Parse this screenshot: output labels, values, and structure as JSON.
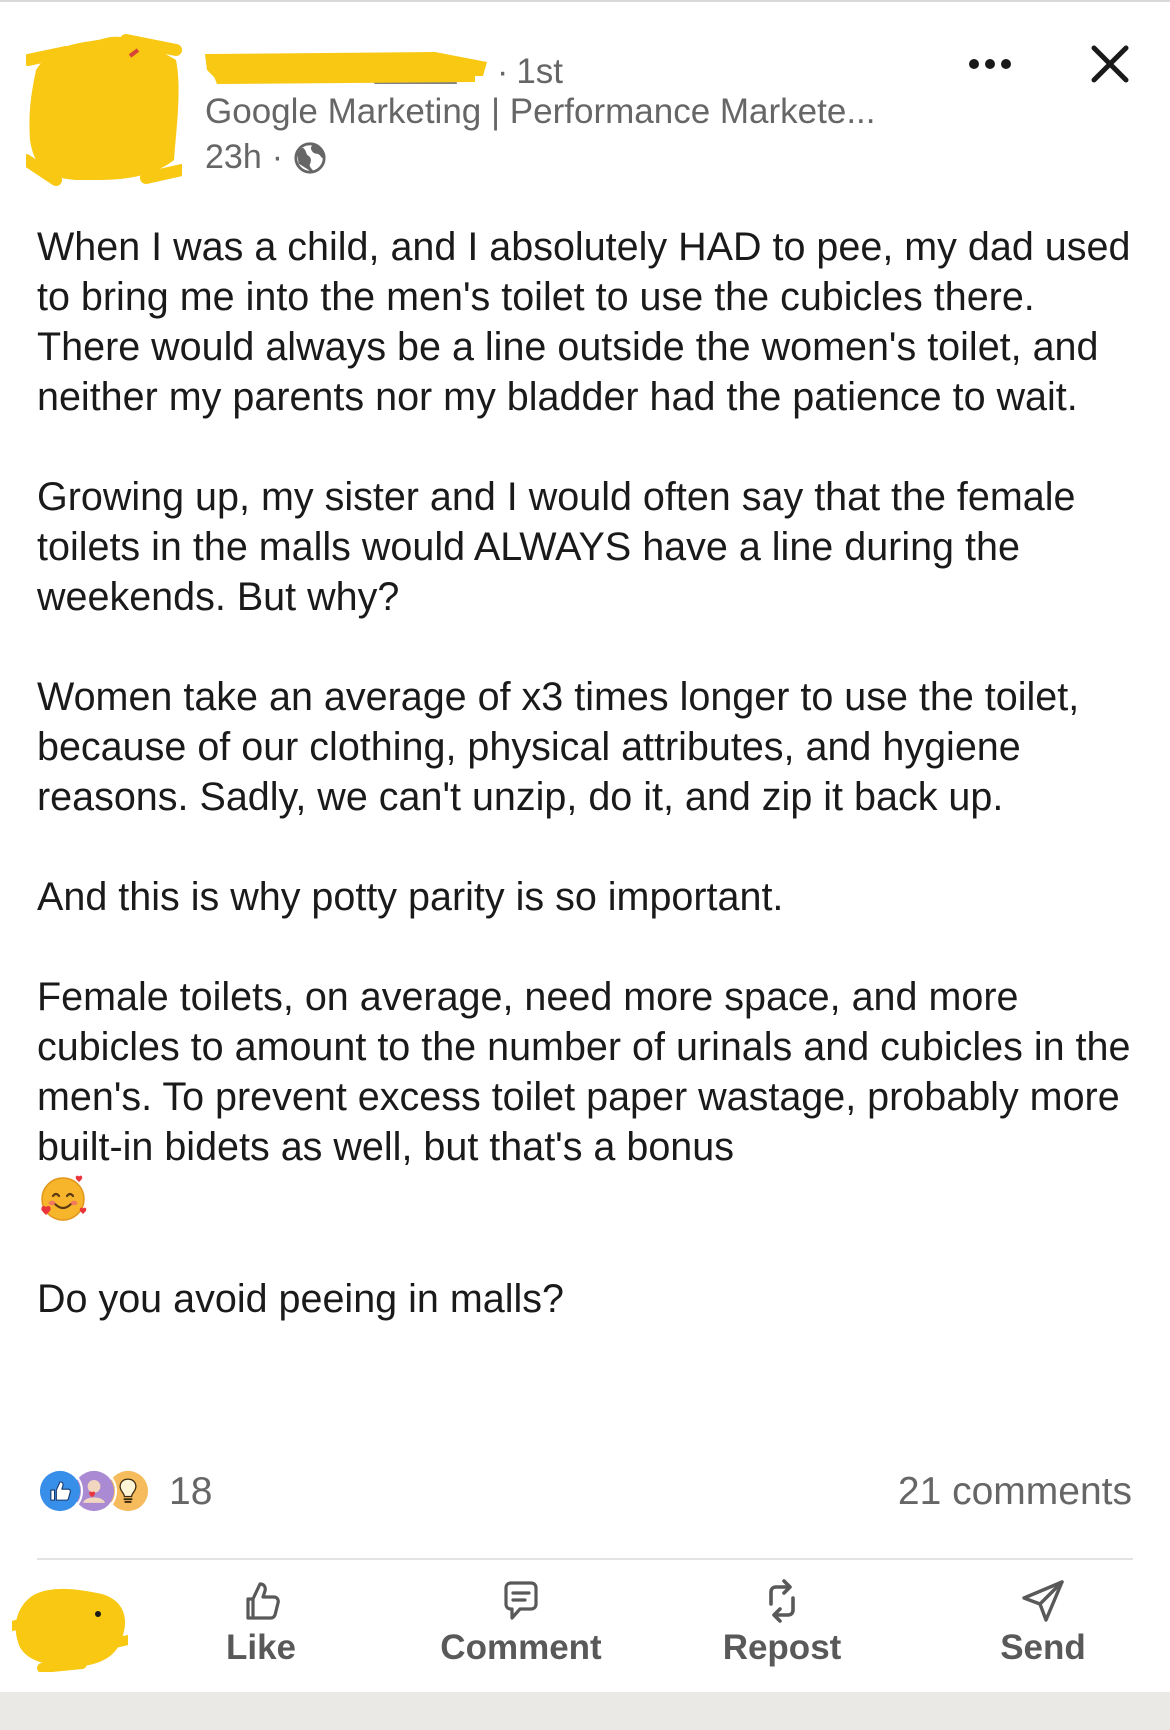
{
  "post": {
    "author": {
      "degree": "1st",
      "headline": "Google Marketing | Performance Markete...",
      "time": "23h",
      "separator": "·"
    },
    "paragraphs": [
      "When I was a child, and I absolutely HAD to pee, my dad used to bring me into the men's toilet to use the cubicles there. There would always be a line outside the women's toilet, and neither my parents nor my bladder had the patience to wait.",
      "Growing up, my sister and I would often say that the female toilets in the malls would ALWAYS have a line during the weekends. But why?",
      "Women take an average of x3 times longer to use the toilet, because of our clothing, physical attributes, and hygiene reasons. Sadly, we can't unzip, do it, and zip it back up.",
      "And this is why potty parity is so important.",
      "Female toilets, on average, need more space, and more cubicles to amount to the number of urinals and cubicles in the men's. To prevent excess toilet paper wastage, probably more built-in bidets as well, but that's a bonus",
      "Do you avoid peeing in malls?"
    ],
    "emoji_icon": "smiling-face-with-hearts-icon"
  },
  "social": {
    "reactions_count": "18",
    "reaction_icons": [
      "like-reaction-icon",
      "love-reaction-icon",
      "insightful-reaction-icon"
    ],
    "comments": "21 comments"
  },
  "actions": {
    "like": "Like",
    "comment": "Comment",
    "repost": "Repost",
    "send": "Send"
  },
  "colors": {
    "text": "#1a1a1a",
    "muted": "#666666",
    "action": "#595959",
    "like_blue": "#378fe9",
    "love_purple": "#a98ad3",
    "insight_yellow": "#f5bb5c",
    "redaction_yellow": "#f8c812"
  }
}
